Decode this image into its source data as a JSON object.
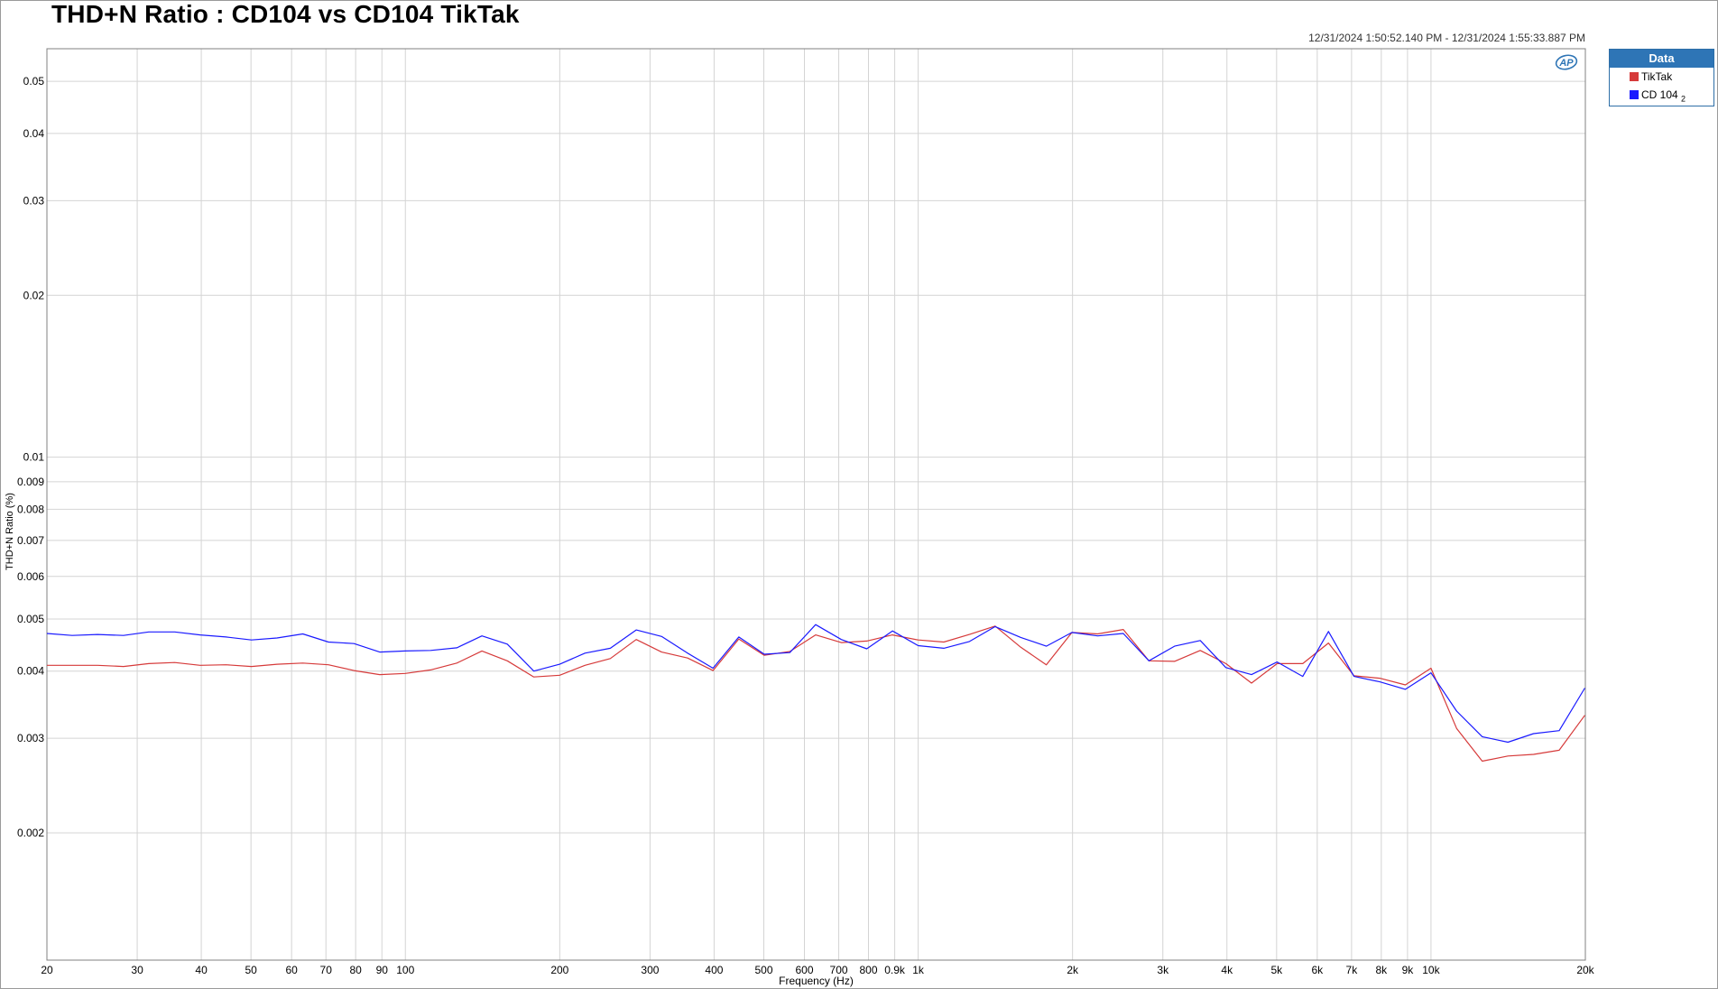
{
  "title": "THD+N Ratio : CD104 vs CD104 TikTak",
  "timestamp": "12/31/2024 1:50:52.140 PM - 12/31/2024 1:55:33.887 PM",
  "legend": {
    "header": "Data",
    "items": [
      {
        "label": "TikTak",
        "color": "#d63a3a"
      },
      {
        "label": "CD 104",
        "suffix": "2",
        "color": "#1a1aff"
      }
    ]
  },
  "logo": "AP",
  "chart_data": {
    "type": "line",
    "xlabel": "Frequency (Hz)",
    "ylabel": "THD+N Ratio (%)",
    "x_scale": "log",
    "y_scale": "log",
    "xlim": [
      20,
      20000
    ],
    "ylim": [
      0.00116,
      0.0575
    ],
    "grid": true,
    "legend_position": "right",
    "x_ticks": [
      20,
      30,
      40,
      50,
      60,
      70,
      80,
      90,
      100,
      200,
      300,
      400,
      500,
      600,
      700,
      800,
      900,
      1000,
      2000,
      3000,
      4000,
      5000,
      6000,
      7000,
      8000,
      9000,
      10000,
      20000
    ],
    "x_tick_labels": [
      "20",
      "30",
      "40",
      "50",
      "60",
      "70",
      "80",
      "90",
      "100",
      "200",
      "300",
      "400",
      "500",
      "600",
      "700",
      "800",
      "0.9k",
      "1k",
      "2k",
      "3k",
      "4k",
      "5k",
      "6k",
      "7k",
      "8k",
      "9k",
      "10k",
      "20k"
    ],
    "y_ticks": [
      0.002,
      0.003,
      0.004,
      0.005,
      0.006,
      0.007,
      0.008,
      0.009,
      0.01,
      0.02,
      0.03,
      0.04,
      0.05
    ],
    "y_tick_labels": [
      "0.002",
      "0.003",
      "0.004",
      "0.005",
      "0.006",
      "0.007",
      "0.008",
      "0.009",
      "0.01",
      "0.02",
      "0.03",
      "0.04",
      "0.05"
    ],
    "x": [
      20,
      22.4,
      25.1,
      28.2,
      31.6,
      35.5,
      39.8,
      44.7,
      50.1,
      56.2,
      63.1,
      70.8,
      79.4,
      89.1,
      100,
      112,
      126,
      141,
      158,
      178,
      200,
      224,
      251,
      282,
      316,
      355,
      398,
      447,
      501,
      562,
      631,
      708,
      794,
      891,
      1000,
      1122,
      1259,
      1413,
      1585,
      1778,
      1995,
      2239,
      2512,
      2818,
      3162,
      3548,
      3981,
      4467,
      5012,
      5623,
      6310,
      7079,
      7943,
      8913,
      10000,
      11220,
      12589,
      14125,
      15849,
      17783,
      19953
    ],
    "series": [
      {
        "name": "TikTak",
        "color": "#d63a3a",
        "values": [
          0.0041,
          0.0041,
          0.0041,
          0.00408,
          0.00413,
          0.00415,
          0.0041,
          0.00411,
          0.00408,
          0.00412,
          0.00414,
          0.00411,
          0.00401,
          0.00394,
          0.00396,
          0.00402,
          0.00414,
          0.00436,
          0.00418,
          0.0039,
          0.00393,
          0.0041,
          0.00422,
          0.00458,
          0.00434,
          0.00423,
          0.00401,
          0.00459,
          0.00428,
          0.00435,
          0.00467,
          0.00452,
          0.00455,
          0.00467,
          0.00457,
          0.00453,
          0.00468,
          0.00485,
          0.00443,
          0.00411,
          0.00472,
          0.00469,
          0.00478,
          0.00418,
          0.00417,
          0.00437,
          0.00413,
          0.0038,
          0.00413,
          0.00413,
          0.00451,
          0.00392,
          0.00388,
          0.00377,
          0.00405,
          0.00313,
          0.00272,
          0.00278,
          0.0028,
          0.00285,
          0.00331
        ]
      },
      {
        "name": "CD 104",
        "color": "#1a1aff",
        "values": [
          0.0047,
          0.00466,
          0.00468,
          0.00466,
          0.00473,
          0.00473,
          0.00467,
          0.00463,
          0.00457,
          0.00461,
          0.00469,
          0.00453,
          0.0045,
          0.00434,
          0.00436,
          0.00437,
          0.00442,
          0.00465,
          0.00449,
          0.004,
          0.00412,
          0.00432,
          0.00441,
          0.00477,
          0.00464,
          0.00432,
          0.00405,
          0.00463,
          0.0043,
          0.00433,
          0.00488,
          0.00458,
          0.0044,
          0.00475,
          0.00446,
          0.00441,
          0.00454,
          0.00484,
          0.00462,
          0.00445,
          0.00472,
          0.00465,
          0.0047,
          0.00418,
          0.00445,
          0.00456,
          0.00406,
          0.00394,
          0.00416,
          0.00391,
          0.00474,
          0.00391,
          0.00382,
          0.0037,
          0.00397,
          0.00337,
          0.00302,
          0.00295,
          0.00306,
          0.0031,
          0.00372
        ]
      }
    ]
  }
}
